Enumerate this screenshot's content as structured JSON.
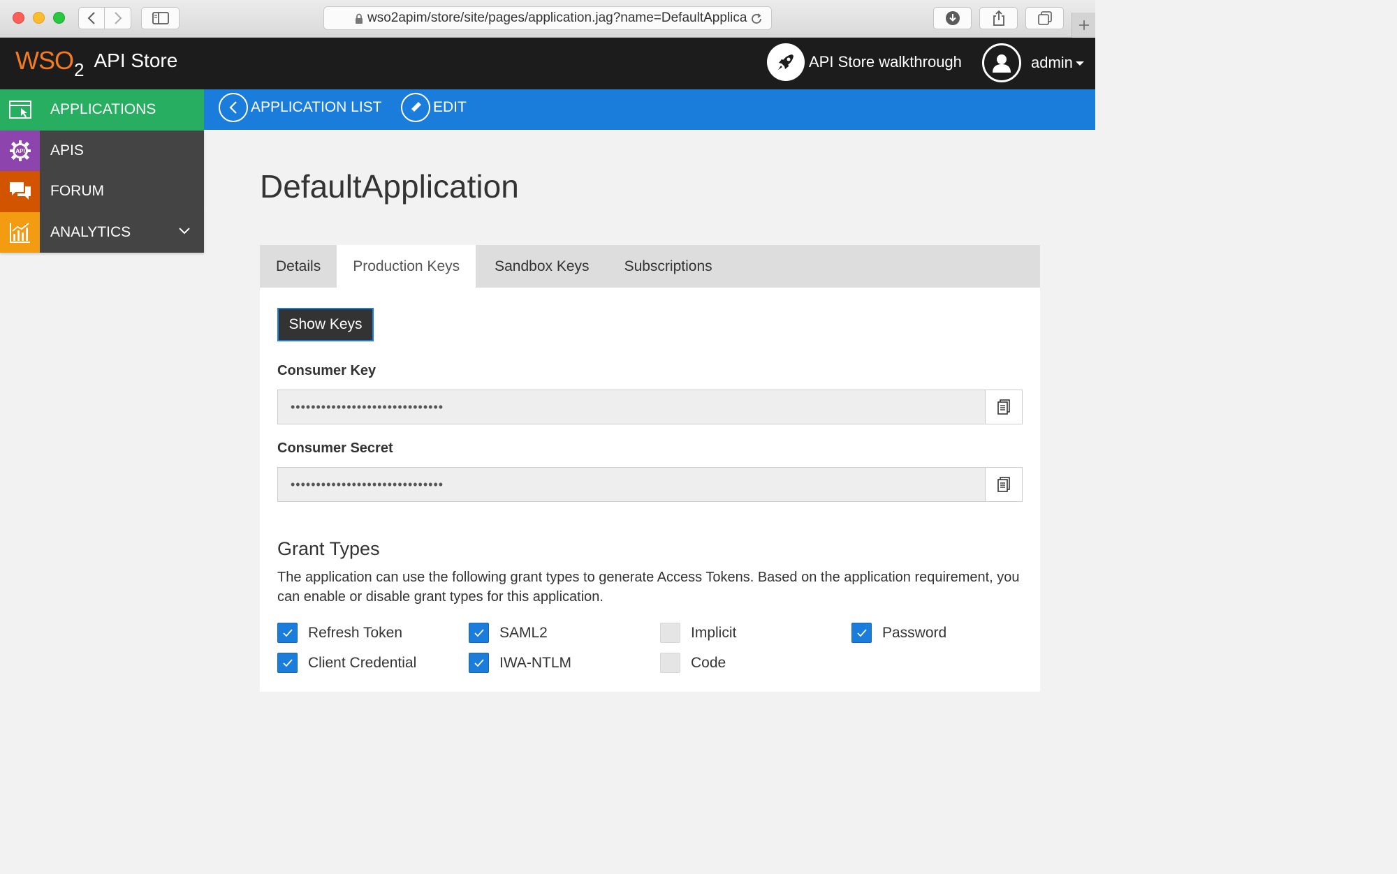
{
  "browser": {
    "url": "wso2apim/store/site/pages/application.jag?name=DefaultApplica"
  },
  "header": {
    "logo_text": "WSO",
    "logo_subscript": "2",
    "app_title": "API Store",
    "walkthrough_label": "API Store walkthrough",
    "user_name": "admin"
  },
  "sidebar": {
    "items": [
      {
        "label": "APPLICATIONS",
        "icon": "window-cursor-icon",
        "color": "#27ae60"
      },
      {
        "label": "APIS",
        "icon": "api-gear-icon",
        "color": "#8e44ad"
      },
      {
        "label": "FORUM",
        "icon": "chat-bubbles-icon",
        "color": "#d35400"
      },
      {
        "label": "ANALYTICS",
        "icon": "bar-chart-icon",
        "color": "#f39c12"
      }
    ]
  },
  "nav": {
    "back_label": "APPLICATION LIST",
    "edit_label": "EDIT"
  },
  "page": {
    "title": "DefaultApplication",
    "tabs": [
      "Details",
      "Production Keys",
      "Sandbox Keys",
      "Subscriptions"
    ],
    "active_tab": "Production Keys",
    "show_keys_label": "Show Keys",
    "consumer_key_label": "Consumer Key",
    "consumer_key_value": "••••••••••••••••••••••••••••••",
    "consumer_secret_label": "Consumer Secret",
    "consumer_secret_value": "••••••••••••••••••••••••••••••",
    "grant_types_title": "Grant Types",
    "grant_types_desc": "The application can use the following grant types to generate Access Tokens. Based on the application requirement, you can enable or disable grant types for this application.",
    "grants": [
      {
        "label": "Refresh Token",
        "checked": true
      },
      {
        "label": "SAML2",
        "checked": true
      },
      {
        "label": "Implicit",
        "checked": false
      },
      {
        "label": "Password",
        "checked": true
      },
      {
        "label": "Client Credential",
        "checked": true
      },
      {
        "label": "IWA-NTLM",
        "checked": true
      },
      {
        "label": "Code",
        "checked": false
      }
    ]
  },
  "colors": {
    "accent_blue": "#1a7cdb",
    "header_bg": "#1c1c1c",
    "brand_orange": "#f47b20"
  }
}
